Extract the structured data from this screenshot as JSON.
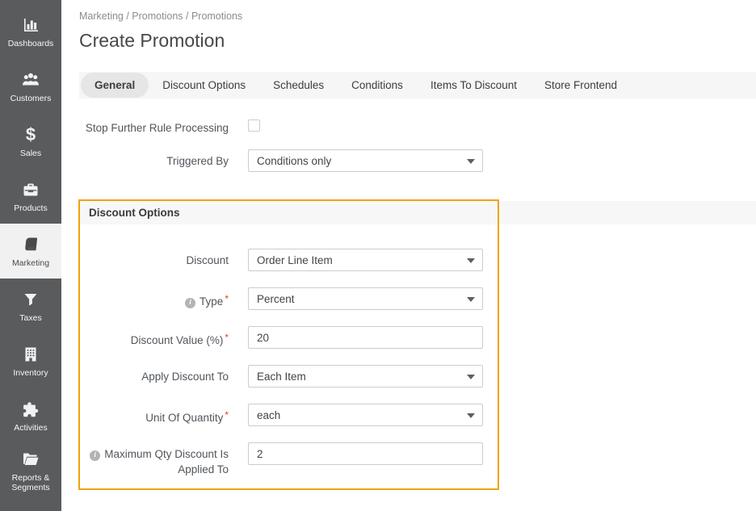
{
  "colors": {
    "sidebar_bg": "#5a5b5d",
    "sidebar_active_bg": "#f1f1f1",
    "highlight_border": "#f0a40a",
    "required_red": "#e0402f",
    "tabbar_bg": "#f6f6f6",
    "section_band_bg": "#f7f7f7"
  },
  "sidebar": {
    "items": [
      {
        "label": "Dashboards",
        "icon": "bar-chart-icon",
        "active": false
      },
      {
        "label": "Customers",
        "icon": "people-icon",
        "active": false
      },
      {
        "label": "Sales",
        "icon": "dollar-icon",
        "active": false
      },
      {
        "label": "Products",
        "icon": "briefcase-icon",
        "active": false
      },
      {
        "label": "Marketing",
        "icon": "book-icon",
        "active": true
      },
      {
        "label": "Taxes",
        "icon": "funnel-icon",
        "active": false
      },
      {
        "label": "Inventory",
        "icon": "building-icon",
        "active": false
      },
      {
        "label": "Activities",
        "icon": "puzzle-icon",
        "active": false
      },
      {
        "label": "Reports & Segments",
        "icon": "folder-icon",
        "active": false
      }
    ],
    "dollar_glyph": "$"
  },
  "header": {
    "breadcrumb": "Marketing / Promotions / Promotions",
    "title": "Create Promotion"
  },
  "tabs": [
    {
      "label": "General",
      "active": true
    },
    {
      "label": "Discount Options",
      "active": false
    },
    {
      "label": "Schedules",
      "active": false
    },
    {
      "label": "Conditions",
      "active": false
    },
    {
      "label": "Items To Discount",
      "active": false
    },
    {
      "label": "Store Frontend",
      "active": false
    }
  ],
  "form": {
    "required_marker": "*",
    "info_glyph": "i",
    "stop_further_rule": {
      "label": "Stop Further Rule Processing",
      "checked": false
    },
    "triggered_by": {
      "label": "Triggered By",
      "value": "Conditions only"
    }
  },
  "discount_section": {
    "title": "Discount Options",
    "fields": [
      {
        "label": "Discount",
        "value": "Order Line Item",
        "control": "select",
        "required": false,
        "info": false
      },
      {
        "label": "Type",
        "value": "Percent",
        "control": "select",
        "required": true,
        "info": true
      },
      {
        "label": "Discount Value (%)",
        "value": "20",
        "control": "text",
        "required": true,
        "info": false
      },
      {
        "label": "Apply Discount To",
        "value": "Each Item",
        "control": "select",
        "required": false,
        "info": false
      },
      {
        "label": "Unit Of Quantity",
        "value": "each",
        "control": "select",
        "required": true,
        "info": false
      },
      {
        "label": "Maximum Qty Discount Is Applied To",
        "value": "2",
        "control": "text",
        "required": false,
        "info": true
      }
    ]
  }
}
